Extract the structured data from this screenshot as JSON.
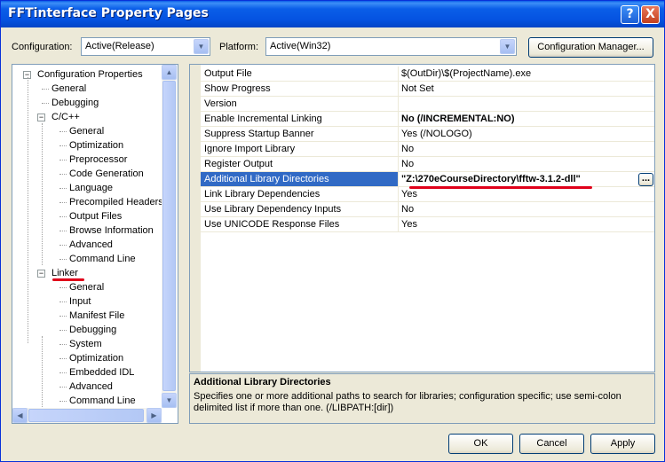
{
  "window": {
    "title": "FFTinterface Property Pages",
    "help_glyph": "?",
    "close_glyph": "X"
  },
  "config_bar": {
    "configuration_label": "Configuration:",
    "configuration_value": "Active(Release)",
    "platform_label": "Platform:",
    "platform_value": "Active(Win32)",
    "manager_button": "Configuration Manager..."
  },
  "tree": {
    "items": [
      {
        "label": "Configuration Properties",
        "indent": 0,
        "expander": "minus"
      },
      {
        "label": "General",
        "indent": 1
      },
      {
        "label": "Debugging",
        "indent": 1
      },
      {
        "label": "C/C++",
        "indent": 1,
        "expander": "minus"
      },
      {
        "label": "General",
        "indent": 2
      },
      {
        "label": "Optimization",
        "indent": 2
      },
      {
        "label": "Preprocessor",
        "indent": 2
      },
      {
        "label": "Code Generation",
        "indent": 2
      },
      {
        "label": "Language",
        "indent": 2
      },
      {
        "label": "Precompiled Headers",
        "indent": 2
      },
      {
        "label": "Output Files",
        "indent": 2
      },
      {
        "label": "Browse Information",
        "indent": 2
      },
      {
        "label": "Advanced",
        "indent": 2
      },
      {
        "label": "Command Line",
        "indent": 2
      },
      {
        "label": "Linker",
        "indent": 1,
        "expander": "minus",
        "highlighted": true
      },
      {
        "label": "General",
        "indent": 2
      },
      {
        "label": "Input",
        "indent": 2
      },
      {
        "label": "Manifest File",
        "indent": 2
      },
      {
        "label": "Debugging",
        "indent": 2
      },
      {
        "label": "System",
        "indent": 2
      },
      {
        "label": "Optimization",
        "indent": 2
      },
      {
        "label": "Embedded IDL",
        "indent": 2
      },
      {
        "label": "Advanced",
        "indent": 2
      },
      {
        "label": "Command Line",
        "indent": 2
      }
    ]
  },
  "properties": [
    {
      "name": "Output File",
      "value": "$(OutDir)\\$(ProjectName).exe"
    },
    {
      "name": "Show Progress",
      "value": "Not Set"
    },
    {
      "name": "Version",
      "value": ""
    },
    {
      "name": "Enable Incremental Linking",
      "value": "No (/INCREMENTAL:NO)",
      "bold": true
    },
    {
      "name": "Suppress Startup Banner",
      "value": "Yes (/NOLOGO)"
    },
    {
      "name": "Ignore Import Library",
      "value": "No"
    },
    {
      "name": "Register Output",
      "value": "No"
    },
    {
      "name": "Additional Library Directories",
      "value": "\"Z:\\270eCourseDirectory\\fftw-3.1.2-dll\"",
      "bold": true,
      "selected": true
    },
    {
      "name": "Link Library Dependencies",
      "value": "Yes"
    },
    {
      "name": "Use Library Dependency Inputs",
      "value": "No"
    },
    {
      "name": "Use UNICODE Response Files",
      "value": "Yes"
    }
  ],
  "ellipsis_button": "...",
  "description": {
    "title": "Additional Library Directories",
    "text": "Specifies one or more additional paths to search for libraries; configuration specific; use semi-colon delimited list if more than one.     (/LIBPATH:[dir])"
  },
  "buttons": {
    "ok": "OK",
    "cancel": "Cancel",
    "apply": "Apply"
  },
  "colors": {
    "selection": "#316ac5",
    "annotation": "#e0001a",
    "title_bar": "#0a5ee8"
  }
}
